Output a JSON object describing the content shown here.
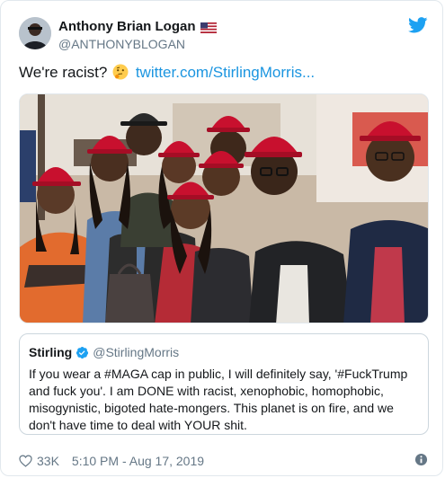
{
  "tweet": {
    "display_name": "Anthony Brian Logan",
    "handle": "@ANTHONYBLOGAN",
    "text_prefix": "We're racist?",
    "link_text": "twitter.com/StirlingMorris...",
    "likes": "33K",
    "timestamp": "5:10 PM - Aug 17, 2019"
  },
  "quote": {
    "display_name": "Stirling",
    "handle": "@StirlingMorris",
    "text": "If you wear a #MAGA cap in public, I will definitely say, '#FuckTrump and fuck you'. I am DONE with racist, xenophobic, homophobic, misogynistic, bigoted hate-mongers. This planet is on fire, and we don't have time to deal with YOUR shit."
  },
  "icons": {
    "brand": "twitter-bird-icon",
    "flag": "us-flag-icon",
    "emoji": "thinking-face-emoji",
    "verified": "verified-badge-icon",
    "like": "heart-icon",
    "info": "info-icon"
  },
  "colors": {
    "link": "#1b95e0",
    "secondary_text": "#657786",
    "cap_red": "#c8102e"
  }
}
